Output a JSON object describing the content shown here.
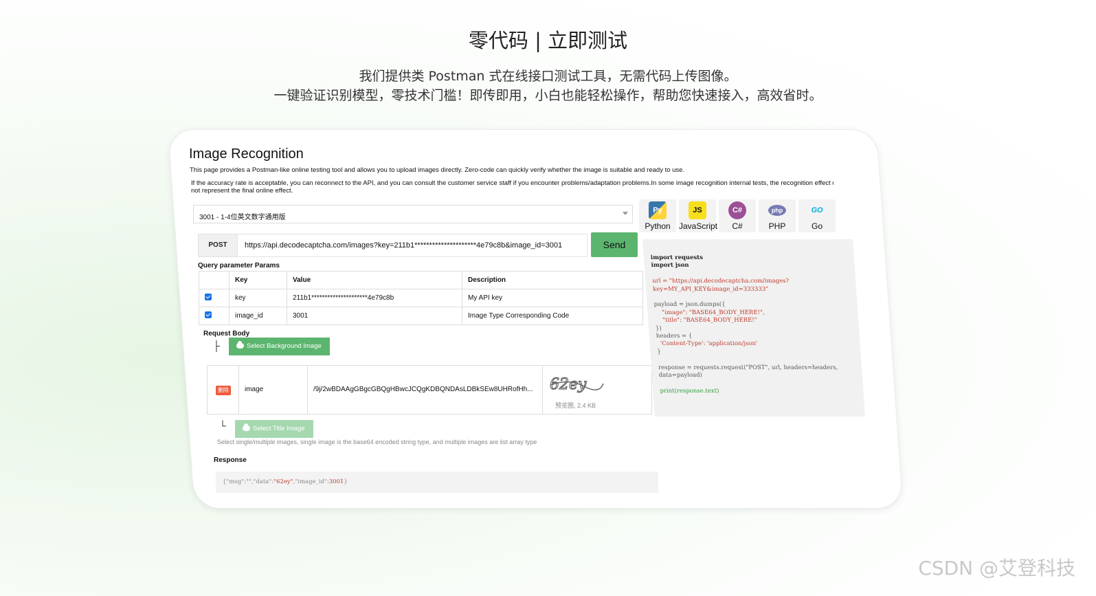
{
  "hero": {
    "title": "零代码 | 立即测试",
    "line1": "我们提供类 Postman 式在线接口测试工具，无需代码上传图像。",
    "line2": "一键验证识别模型，零技术门槛！即传即用，小白也能轻松操作，帮助您快速接入，高效省时。"
  },
  "panel": {
    "title": "Image Recognition",
    "desc1": "This page provides a Postman-like online testing tool and allows you to upload images directly. Zero-code can quickly verify whether the image is suitable and ready to use.",
    "desc2": "If the accuracy rate is acceptable, you can reconnect to the API, and you can consult the customer service staff if you encounter problems/adaptation problems.In some image recognition internal tests, the recognition effect c",
    "desc3": "not represent the final online effect."
  },
  "model_select": {
    "value": "3001 - 1-4位英文数字通用版"
  },
  "languages": [
    {
      "label": "Python",
      "icon": "python-icon",
      "color": "#3776ab"
    },
    {
      "label": "JavaScript",
      "icon": "javascript-icon",
      "color": "#f7df1e"
    },
    {
      "label": "C#",
      "icon": "csharp-icon",
      "color": "#9b4f96"
    },
    {
      "label": "PHP",
      "icon": "php-icon",
      "color": "#777bb3"
    },
    {
      "label": "Go",
      "icon": "go-icon",
      "color": "#00add8"
    }
  ],
  "request": {
    "method": "POST",
    "url": "https://api.decodecaptcha.com/images?key=211b1*********************4e79c8b&image_id=3001",
    "send_label": "Send"
  },
  "params": {
    "section_label": "Query parameter Params",
    "headers": [
      "Key",
      "Value",
      "Description"
    ],
    "rows": [
      {
        "key": "key",
        "value": "211b1*********************4e79c8b",
        "description": "My API key",
        "checked": true
      },
      {
        "key": "image_id",
        "value": "3001",
        "description": "Image Type Corresponding Code",
        "checked": true
      }
    ]
  },
  "body": {
    "section_label": "Request Body",
    "select_bg_label": "Select Background Image",
    "image_row": {
      "delete_label": "删除",
      "field": "image",
      "value": "/9j/2wBDAAgGBgcGBQgHBwcJCQgKDBQNDAsLDBkSEw8UHRofHh...",
      "preview_label": "预览图",
      "size": "2.4 KB"
    },
    "select_title_label": "Select Title Image",
    "hint": "Select single/multiple images, single image is the base64 encoded string type, and multiple images are list array type"
  },
  "response": {
    "label": "Response",
    "text_prefix": "{\"msg\":\"\",\"data\":",
    "data_value": "\"62ey\"",
    "text_mid": ",\"image_id\":",
    "id_value": "3001",
    "text_suffix": "}"
  },
  "code_sample": {
    "line1": "import requests",
    "line2": "import json",
    "line3": "url = \"https://api.decodecaptcha.com/images?",
    "line4": "key=MY_API_KEY&image_id=333333\"",
    "line5": "payload = json.dumps({",
    "line6": "    \"image\": \"BASE64_BODY_HERE!\",",
    "line7": "    \"title\": \"BASE64_BODY_HERE!\"",
    "line8": "})",
    "line9": "headers = {",
    "line10": "  'Content-Type': 'application/json'",
    "line11": "}",
    "line12": "response = requests.request(\"POST\", url, headers=headers,",
    "line13": "data=payload)",
    "line14": "print(response.text)"
  },
  "watermark": "CSDN @艾登科技"
}
